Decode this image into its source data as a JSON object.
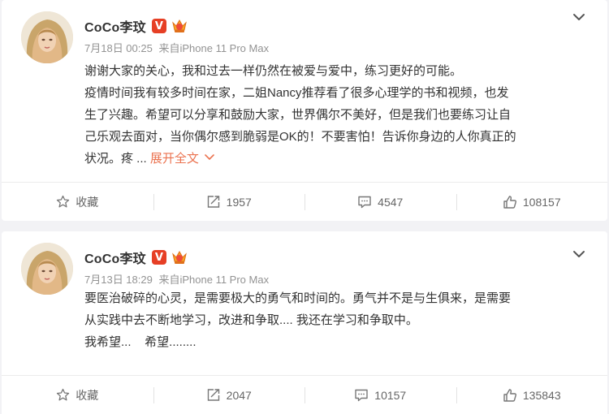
{
  "posts": [
    {
      "username": "CoCo李玟",
      "vip_badge": "V",
      "date": "7月18日 00:25",
      "source_prefix": "来自",
      "source": "iPhone 11 Pro Max",
      "lines": [
        "谢谢大家的关心，我和过去一样仍然在被爱与爱中，练习更好的可能。",
        "疫情时间我有较多时间在家，二姐Nancy推荐看了很多心理学的书和视频，也发",
        "生了兴趣。希望可以分享和鼓励大家，世界偶尔不美好，但是我们也要练习让自",
        "己乐观去面对，当你偶尔感到脆弱是OK的！不要害怕！告诉你身边的人你真正的",
        "状况。疼 ..."
      ],
      "expand_label": "展开全文",
      "actions": {
        "favorite": "收藏",
        "repost": "1957",
        "comment": "4547",
        "like": "108157"
      }
    },
    {
      "username": "CoCo李玟",
      "vip_badge": "V",
      "date": "7月13日 18:29",
      "source_prefix": "来自",
      "source": "iPhone 11 Pro Max",
      "lines": [
        "要医治破碎的心灵，是需要极大的勇气和时间的。勇气并不是与生俱来，是需要",
        "从实践中去不断地学习，改进和争取.... 我还在学习和争取中。",
        "我希望...    希望........"
      ],
      "actions": {
        "favorite": "收藏",
        "repost": "2047",
        "comment": "10157",
        "like": "135843"
      }
    }
  ],
  "colors": {
    "accent_link": "#eb7350",
    "vip_red": "#e63f25",
    "page_bg": "#f2f2f5"
  },
  "icons": [
    "chevron-down-icon",
    "star-icon",
    "repost-icon",
    "comment-icon",
    "like-icon",
    "level-crown-icon"
  ]
}
